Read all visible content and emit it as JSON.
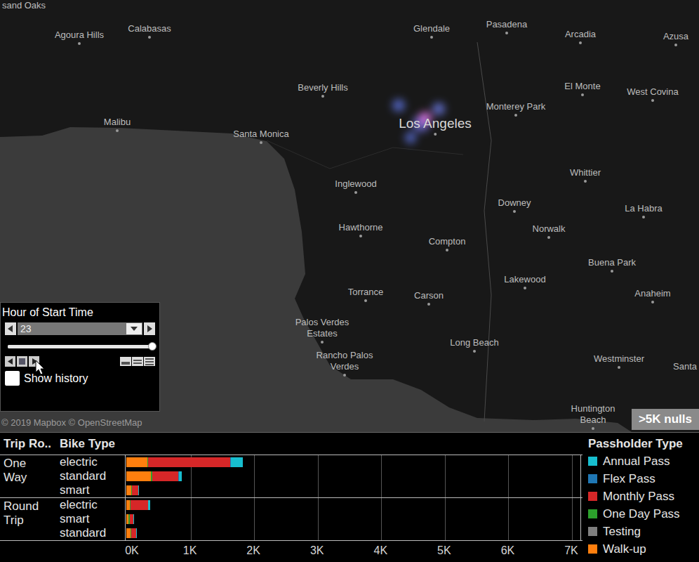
{
  "map": {
    "places": [
      {
        "name": "sand Oaks"
      },
      {
        "name": "Agoura Hills"
      },
      {
        "name": "Calabasas"
      },
      {
        "name": "Glendale"
      },
      {
        "name": "Pasadena"
      },
      {
        "name": "Arcadia"
      },
      {
        "name": "Azusa"
      },
      {
        "name": "Beverly Hills"
      },
      {
        "name": "El Monte"
      },
      {
        "name": "West Covina"
      },
      {
        "name": "Malibu"
      },
      {
        "name": "Santa Monica"
      },
      {
        "name": "Los Angeles"
      },
      {
        "name": "Monterey Park"
      },
      {
        "name": "Whittier"
      },
      {
        "name": "Inglewood"
      },
      {
        "name": "Downey"
      },
      {
        "name": "La Habra"
      },
      {
        "name": "Norwalk"
      },
      {
        "name": "Hawthorne"
      },
      {
        "name": "Compton"
      },
      {
        "name": "Buena Park"
      },
      {
        "name": "Lakewood"
      },
      {
        "name": "Torrance"
      },
      {
        "name": "Carson"
      },
      {
        "name": "Anaheim"
      },
      {
        "name": "Palos Verdes Estates"
      },
      {
        "name": "Rancho Palos Verdes"
      },
      {
        "name": "Long Beach"
      },
      {
        "name": "Westminster"
      },
      {
        "name": "Santa"
      },
      {
        "name": "Huntington Beach"
      }
    ],
    "copyright": "© 2019 Mapbox © OpenStreetMap",
    "nulls_badge": ">5K nulls"
  },
  "filter": {
    "title": "Hour of Start Time",
    "value": "23",
    "slider_level": 1,
    "show_history": {
      "label": "Show history",
      "checked": false
    }
  },
  "chart": {
    "headers": [
      "Trip Ro..",
      "Bike Type"
    ],
    "groups": [
      {
        "label": "One Way",
        "rows": [
          "electric",
          "standard",
          "smart"
        ]
      },
      {
        "label": "Round Trip",
        "rows": [
          "electric",
          "smart",
          "standard"
        ]
      }
    ],
    "axis_ticks": [
      "0K",
      "1K",
      "2K",
      "3K",
      "4K",
      "5K",
      "6K",
      "7K"
    ],
    "series": [
      {
        "name": "Walk-up",
        "color": "#ff7f0e",
        "values": [
          330,
          385,
          77,
          55,
          33,
          66
        ]
      },
      {
        "name": "Testing",
        "color": "#7f7f7f",
        "values": [
          0,
          0,
          0,
          0,
          0,
          0
        ]
      },
      {
        "name": "One Day Pass",
        "color": "#2ca02c",
        "values": [
          10,
          20,
          10,
          10,
          22,
          10
        ]
      },
      {
        "name": "Monthly Pass",
        "color": "#d62728",
        "values": [
          1290,
          410,
          100,
          275,
          55,
          77
        ]
      },
      {
        "name": "Flex Pass",
        "color": "#1f77b4",
        "values": [
          15,
          10,
          0,
          5,
          0,
          0
        ]
      },
      {
        "name": "Annual Pass",
        "color": "#17becf",
        "values": [
          190,
          45,
          5,
          33,
          5,
          5
        ]
      }
    ]
  },
  "legend": {
    "title": "Passholder Type",
    "items": [
      {
        "name": "Annual Pass",
        "color": "#17becf"
      },
      {
        "name": "Flex Pass",
        "color": "#1f77b4"
      },
      {
        "name": "Monthly Pass",
        "color": "#d62728"
      },
      {
        "name": "One Day Pass",
        "color": "#2ca02c"
      },
      {
        "name": "Testing",
        "color": "#7f7f7f"
      },
      {
        "name": "Walk-up",
        "color": "#ff7f0e"
      }
    ]
  }
}
